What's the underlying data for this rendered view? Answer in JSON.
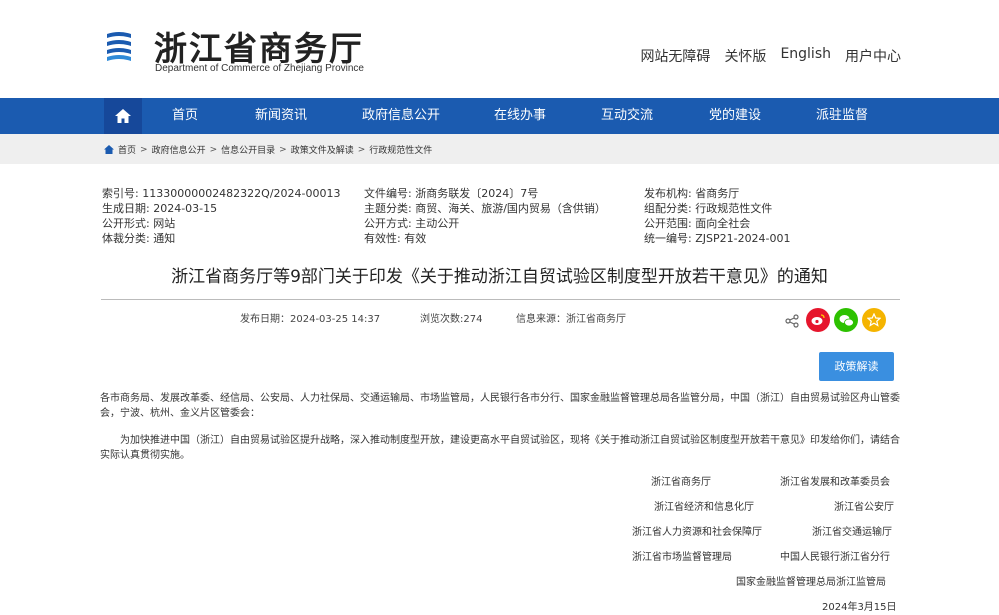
{
  "header": {
    "title": "浙江省商务厅",
    "subtitle": "Department of Commerce of Zhejiang Province",
    "links": [
      "网站无障碍",
      "关怀版",
      "English",
      "用户中心"
    ]
  },
  "nav": {
    "items": [
      "首页",
      "新闻资讯",
      "政府信息公开",
      "在线办事",
      "互动交流",
      "党的建设",
      "派驻监督"
    ]
  },
  "breadcrumb": [
    "首页",
    "政府信息公开",
    "信息公开目录",
    "政策文件及解读",
    "行政规范性文件"
  ],
  "meta": {
    "col1": [
      "索引号: 11330000002482322Q/2024-00013",
      "生成日期: 2024-03-15",
      "公开形式:  网站",
      "体裁分类: 通知"
    ],
    "col2": [
      "文件编号: 浙商务联发〔2024〕7号",
      "主题分类: 商贸、海关、旅游/国内贸易（含供销）",
      "公开方式: 主动公开",
      "有效性: 有效"
    ],
    "col3": [
      "发布机构: 省商务厅",
      "组配分类: 行政规范性文件",
      "公开范围: 面向全社会",
      "统一编号:  ZJSP21-2024-001"
    ]
  },
  "article": {
    "title": "浙江省商务厅等9部门关于印发《关于推动浙江自贸试验区制度型开放若干意见》的通知",
    "publish_date": "发布日期：2024-03-25 14:37",
    "views": "浏览次数:274",
    "source": "信息来源：浙江省商务厅",
    "interpret_button": "政策解读",
    "recipients": "各市商务局、发展改革委、经信局、公安局、人力社保局、交通运输局、市场监管局，人民银行各市分行、国家金融监督管理总局各监管分局，中国（浙江）自由贸易试验区舟山管委会，宁波、杭州、金义片区管委会：",
    "body": "为加快推进中国（浙江）自由贸易试验区提升战略，深入推动制度型开放，建设更高水平自贸试验区，现将《关于推动浙江自贸试验区制度型开放若干意见》印发给你们，请结合实际认真贯彻实施。",
    "signatories": [
      [
        "浙江省商务厅",
        "浙江省发展和改革委员会"
      ],
      [
        "浙江省经济和信息化厅",
        "浙江省公安厅"
      ],
      [
        "浙江省人力资源和社会保障厅",
        "浙江省交通运输厅"
      ],
      [
        "浙江省市场监督管理局",
        "中国人民银行浙江省分行"
      ],
      [
        "国家金融监督管理总局浙江监管局"
      ]
    ],
    "date": "2024年3月15日"
  },
  "social": {
    "colors": {
      "weibo": "#e6162d",
      "wechat": "#2dc100",
      "favorite": "#f5b400"
    },
    "icons": [
      "share-icon",
      "weibo-icon",
      "wechat-icon",
      "star-icon"
    ]
  }
}
